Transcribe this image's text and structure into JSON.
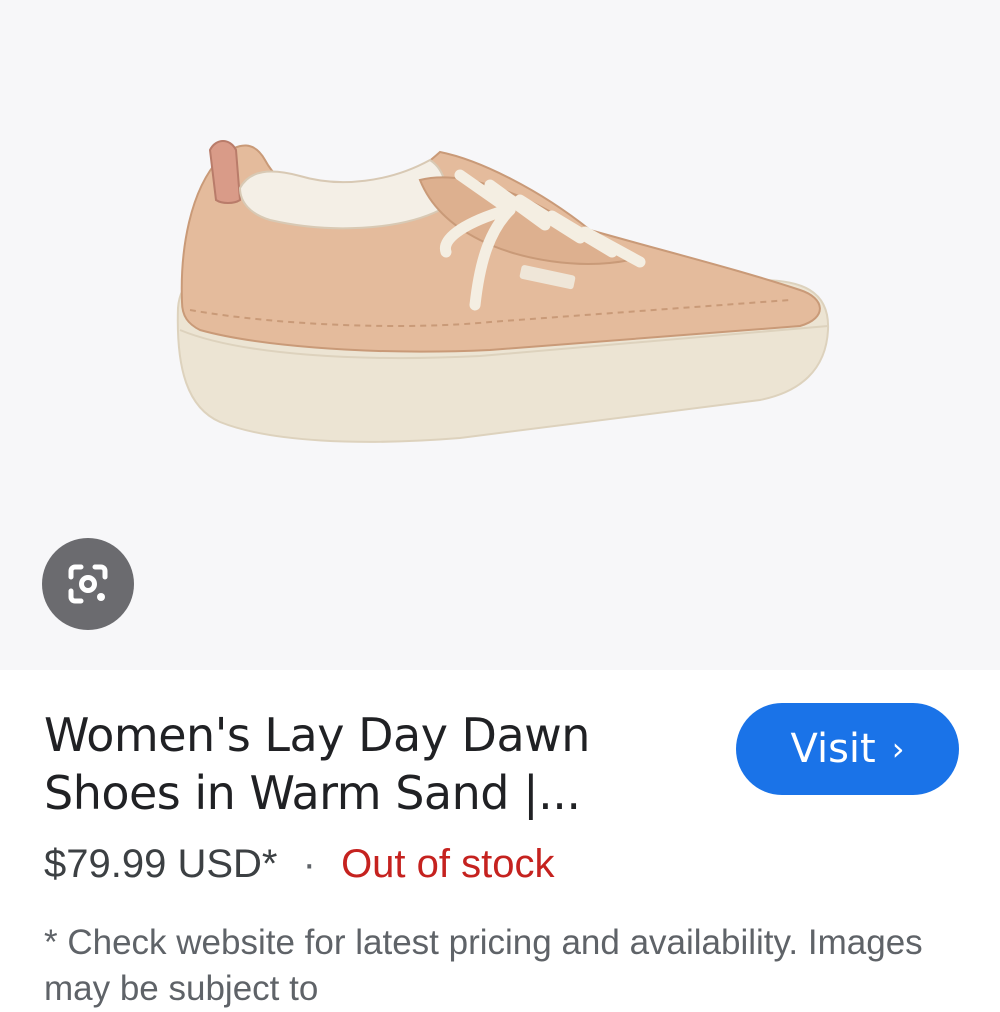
{
  "product": {
    "image_alt": "Women's Lay Day Dawn sneaker in warm sand suede",
    "title_line1": "Women's Lay Day Dawn",
    "title_line2": "Shoes in Warm Sand |...",
    "price": "$79.99 USD*",
    "separator": "·",
    "stock_status": "Out of stock",
    "disclaimer": "* Check website for latest pricing and availability. Images may be subject to"
  },
  "actions": {
    "visit_label": "Visit",
    "visit_chevron": "›",
    "lens_icon": "google-lens-icon"
  },
  "colors": {
    "accent": "#1a73e8",
    "out_of_stock": "#c5221f",
    "image_bg": "#f7f7f9",
    "lens_bg": "#6b6b6f"
  }
}
